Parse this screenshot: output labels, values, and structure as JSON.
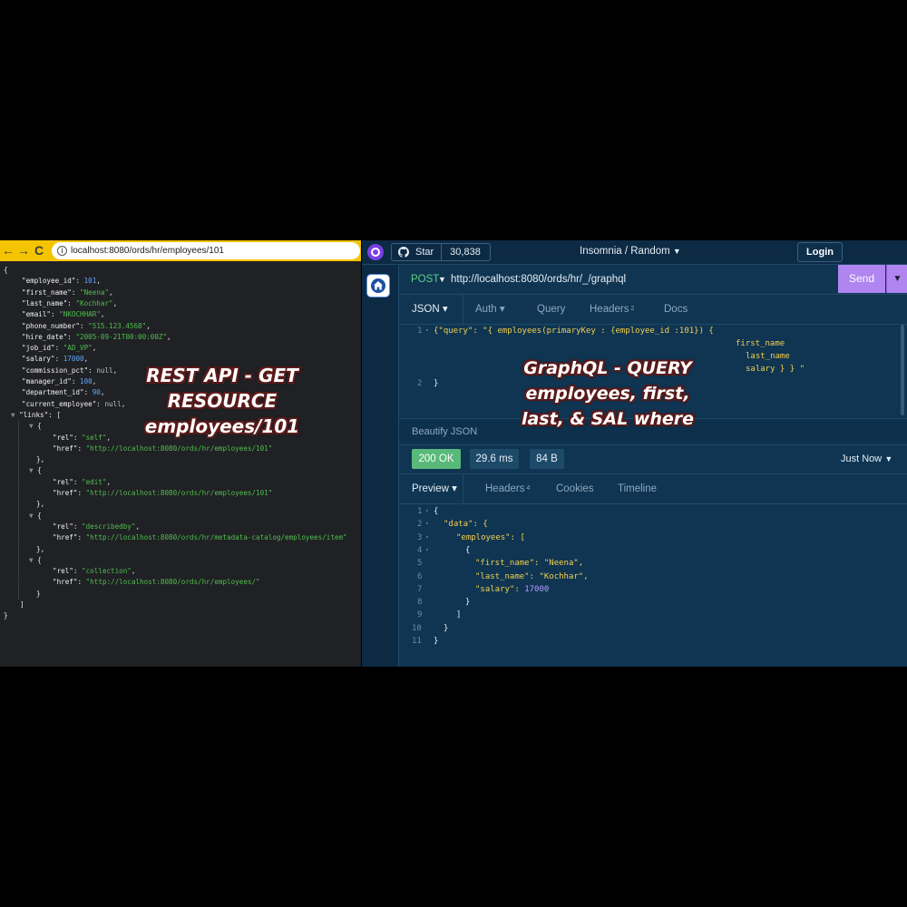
{
  "browser": {
    "back_glyph": "←",
    "forward_glyph": "→",
    "reload_glyph": "C",
    "url": "localhost:8080/ords/hr/employees/101",
    "icons": [
      "back-arrow-icon",
      "forward-arrow-icon",
      "reload-icon",
      "site-info-icon"
    ]
  },
  "rest_json": {
    "open_brace": "{",
    "close_brace": "}",
    "fields": [
      {
        "key": "\"employee_id\"",
        "value": "101",
        "kind": "n"
      },
      {
        "key": "\"first_name\"",
        "value": "\"Neena\"",
        "kind": "s"
      },
      {
        "key": "\"last_name\"",
        "value": "\"Kochhar\"",
        "kind": "s"
      },
      {
        "key": "\"email\"",
        "value": "\"NKOCHHAR\"",
        "kind": "s"
      },
      {
        "key": "\"phone_number\"",
        "value": "\"515.123.4568\"",
        "kind": "s"
      },
      {
        "key": "\"hire_date\"",
        "value": "\"2005-09-21T00:00:00Z\"",
        "kind": "s"
      },
      {
        "key": "\"job_id\"",
        "value": "\"AD_VP\"",
        "kind": "s"
      },
      {
        "key": "\"salary\"",
        "value": "17000",
        "kind": "n"
      },
      {
        "key": "\"commission_pct\"",
        "value": "null",
        "kind": "nl"
      },
      {
        "key": "\"manager_id\"",
        "value": "100",
        "kind": "n"
      },
      {
        "key": "\"department_id\"",
        "value": "90",
        "kind": "n"
      },
      {
        "key": "\"current_employee\"",
        "value": "null",
        "kind": "nl"
      }
    ],
    "links_key": "\"links\"",
    "links": [
      {
        "rel": "\"self\"",
        "href": "\"http://localhost:8080/ords/hr/employees/101\""
      },
      {
        "rel": "\"edit\"",
        "href": "\"http://localhost:8080/ords/hr/employees/101\""
      },
      {
        "rel": "\"describedby\"",
        "href": "\"http://localhost:8080/ords/hr/metadata-catalog/employees/item\""
      },
      {
        "rel": "\"collection\"",
        "href": "\"http://localhost:8080/ords/hr/employees/\""
      }
    ],
    "rel_key": "\"rel\"",
    "href_key": "\"href\""
  },
  "insomnia": {
    "star_label": "Star",
    "star_count": "30,838",
    "project_title": "Insomnia / Random",
    "login_label": "Login",
    "method": "POST",
    "request_url": "http://localhost:8080/ords/hr/_/graphql",
    "send_label": "Send",
    "request_tabs": [
      {
        "label": "JSON",
        "active": true
      },
      {
        "label": "Auth",
        "active": false
      },
      {
        "label": "Query",
        "active": false
      },
      {
        "label": "Headers",
        "active": false,
        "count": "2"
      },
      {
        "label": "Docs",
        "active": false
      }
    ],
    "body_lines": [
      {
        "num": "1",
        "text": "{\"query\": \"{ employees(primaryKey : {employee_id :101}) {"
      },
      {
        "num": "",
        "text": "first_name"
      },
      {
        "num": "",
        "text": "last_name"
      },
      {
        "num": "",
        "text": "salary } } \""
      },
      {
        "num": "2",
        "text": "}"
      }
    ],
    "beautify_label": "Beautify JSON",
    "status": "200 OK",
    "time": "29.6 ms",
    "size": "84 B",
    "timestamp": "Just Now",
    "response_tabs": [
      {
        "label": "Preview",
        "active": true
      },
      {
        "label": "Headers",
        "active": false,
        "count": "4"
      },
      {
        "label": "Cookies",
        "active": false
      },
      {
        "label": "Timeline",
        "active": false
      }
    ],
    "response_lines": [
      {
        "num": "1",
        "text": "{"
      },
      {
        "num": "2",
        "text": "\"data\": {"
      },
      {
        "num": "3",
        "text": "\"employees\": ["
      },
      {
        "num": "4",
        "text": "{"
      },
      {
        "num": "5",
        "text": "\"first_name\": \"Neena\","
      },
      {
        "num": "6",
        "text": "\"last_name\": \"Kochhar\","
      },
      {
        "num": "7",
        "text": "\"salary\": 17000"
      },
      {
        "num": "8",
        "text": "}"
      },
      {
        "num": "9",
        "text": "]"
      },
      {
        "num": "10",
        "text": "}"
      },
      {
        "num": "11",
        "text": "}"
      }
    ],
    "icons": [
      "insomnia-logo-icon",
      "github-icon",
      "home-icon",
      "dropdown-caret-icon"
    ]
  },
  "overlays": {
    "rest_caption": [
      "REST API - GET",
      "RESOURCE",
      "employees/101"
    ],
    "graphql_caption": [
      "GraphQL - QUERY",
      "employees, first,",
      "last, & SAL where"
    ]
  },
  "colors": {
    "browser_bar": "#f5c400",
    "insomnia_bg": "#0f3552",
    "send_button": "#b085f0",
    "status_ok": "#59b97a"
  }
}
